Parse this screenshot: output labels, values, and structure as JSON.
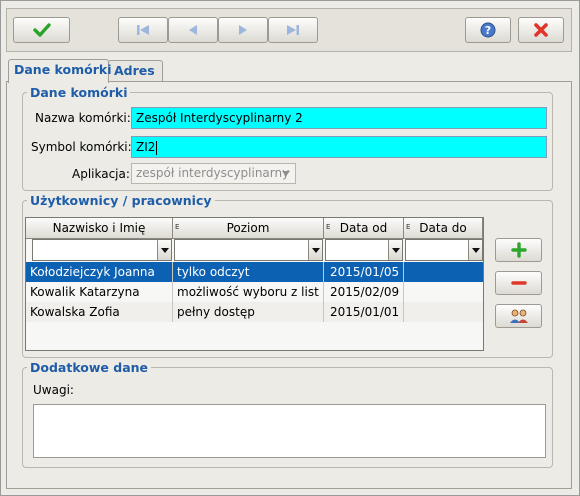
{
  "toolbar": {
    "ok_icon": "check-icon",
    "first_icon": "first-record-icon",
    "prev_icon": "previous-record-icon",
    "next_icon": "next-record-icon",
    "last_icon": "last-record-icon",
    "help_icon": "help-icon",
    "cancel_icon": "close-icon"
  },
  "tabs": [
    {
      "label": "Dane komórki",
      "active": true
    },
    {
      "label": "Adres",
      "active": false
    }
  ],
  "cell_group": {
    "title": "Dane komórki",
    "name_label": "Nazwa komórki:",
    "name_value": "Zespół Interdyscyplinarny 2",
    "symbol_label": "Symbol komórki:",
    "symbol_value": "ZI2",
    "app_label": "Aplikacja:",
    "app_value": "zespół interdyscyplinarny"
  },
  "users_group": {
    "title": "Użytkownicy / pracownicy",
    "columns": [
      "Nazwisko i Imię",
      "Poziom",
      "Data od",
      "Data do"
    ],
    "rows": [
      {
        "name": "Kołodziejczyk Joanna",
        "level": "tylko odczyt",
        "from": "2015/01/05",
        "to": ""
      },
      {
        "name": "Kowalik Katarzyna",
        "level": "możliwość wyboru z list",
        "from": "2015/02/09",
        "to": ""
      },
      {
        "name": "Kowalska Zofia",
        "level": "pełny dostęp",
        "from": "2015/01/01",
        "to": ""
      }
    ],
    "add_icon": "plus-icon",
    "remove_icon": "minus-icon",
    "users_icon": "users-icon"
  },
  "extra_group": {
    "title": "Dodatkowe dane",
    "notes_label": "Uwagi:",
    "notes_value": ""
  },
  "colors": {
    "accent": "#1f5da8",
    "field_bg": "#00ffff",
    "selection": "#0d61b3"
  }
}
